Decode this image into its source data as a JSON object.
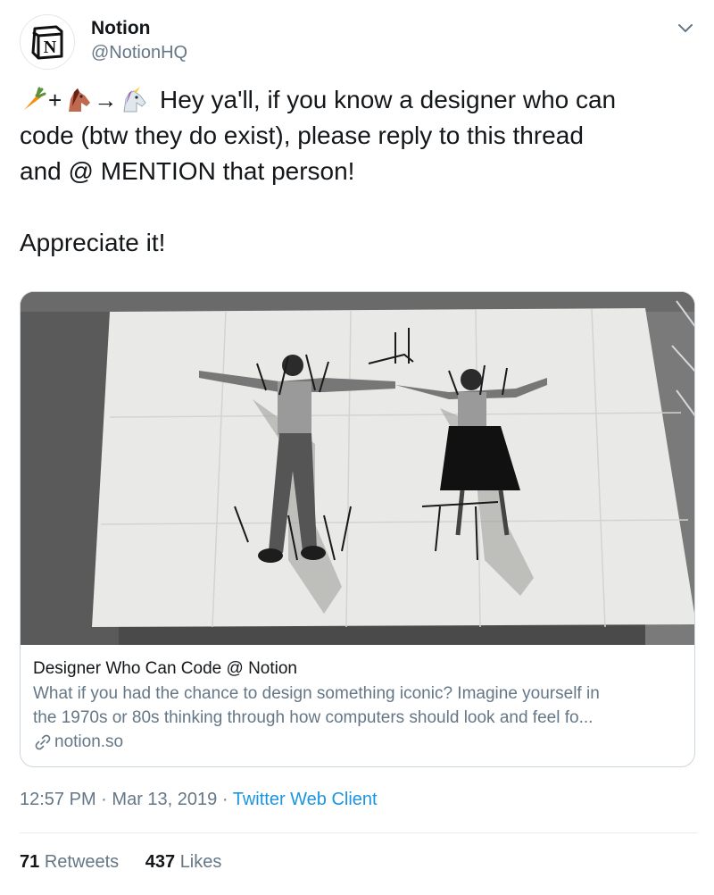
{
  "author": {
    "display_name": "Notion",
    "handle": "@NotionHQ",
    "avatar_icon": "notion-logo-icon",
    "avatar_letter": "N"
  },
  "tweet": {
    "emoji_icons": [
      "carrot-emoji-icon",
      "horse-emoji-icon",
      "unicorn-emoji-icon"
    ],
    "emoji_operators": [
      "+",
      "→"
    ],
    "line1": "Hey ya'll, if you know a designer who can",
    "line2": "code (btw they do exist), please reply to this thread",
    "line3": "and @ MENTION that person!",
    "line4": "Appreciate it!"
  },
  "card": {
    "image_icon": "eames-photo-image",
    "title": "Designer Who Can Code @ Notion",
    "description_line1": "What if you had the chance to design something iconic? Imagine yourself in",
    "description_line2": "the 1970s or 80s thinking through how computers should look and feel fo...",
    "domain": "notion.so",
    "link_icon": "link-icon"
  },
  "meta": {
    "time": "12:57 PM",
    "separator": "·",
    "date": "Mar 13, 2019",
    "client": "Twitter Web Client"
  },
  "stats": {
    "retweets_count": "71",
    "retweets_label": "Retweets",
    "likes_count": "437",
    "likes_label": "Likes"
  },
  "colors": {
    "text": "#14171a",
    "secondary": "#657786",
    "link": "#1b95e0",
    "border": "#ccd6dd"
  }
}
